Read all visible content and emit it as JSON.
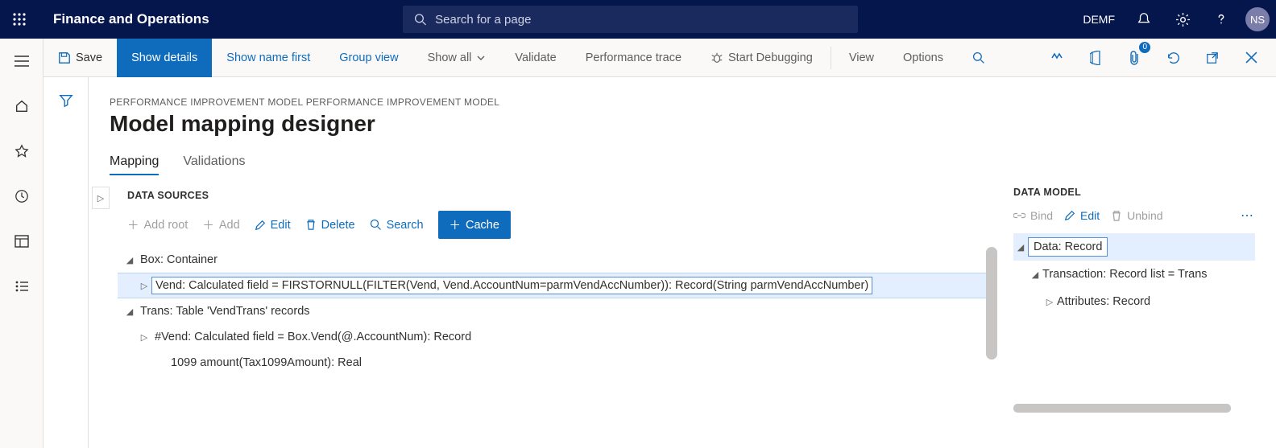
{
  "app": {
    "title": "Finance and Operations",
    "company": "DEMF",
    "user_initials": "NS"
  },
  "search": {
    "placeholder": "Search for a page"
  },
  "actionbar": {
    "save": "Save",
    "show_details": "Show details",
    "show_name_first": "Show name first",
    "group_view": "Group view",
    "show_all": "Show all",
    "validate": "Validate",
    "perf_trace": "Performance trace",
    "start_debug": "Start Debugging",
    "view": "View",
    "options": "Options",
    "attach_badge": "0"
  },
  "page": {
    "breadcrumb": "PERFORMANCE IMPROVEMENT MODEL PERFORMANCE IMPROVEMENT MODEL",
    "title": "Model mapping designer",
    "tabs": {
      "mapping": "Mapping",
      "validations": "Validations"
    }
  },
  "datasources": {
    "heading": "DATA SOURCES",
    "toolbar": {
      "add_root": "Add root",
      "add": "Add",
      "edit": "Edit",
      "delete": "Delete",
      "search": "Search",
      "cache": "Cache"
    },
    "tree": {
      "box": "Box: Container",
      "vend": "Vend: Calculated field = FIRSTORNULL(FILTER(Vend, Vend.AccountNum=parmVendAccNumber)): Record(String parmVendAccNumber)",
      "trans": "Trans: Table 'VendTrans' records",
      "hashvend": "#Vend: Calculated field = Box.Vend(@.AccountNum): Record",
      "amount": "1099 amount(Tax1099Amount): Real"
    }
  },
  "datamodel": {
    "heading": "DATA MODEL",
    "toolbar": {
      "bind": "Bind",
      "edit": "Edit",
      "unbind": "Unbind"
    },
    "tree": {
      "data": "Data: Record",
      "transaction": "Transaction: Record list = Trans",
      "attributes": "Attributes: Record"
    }
  }
}
